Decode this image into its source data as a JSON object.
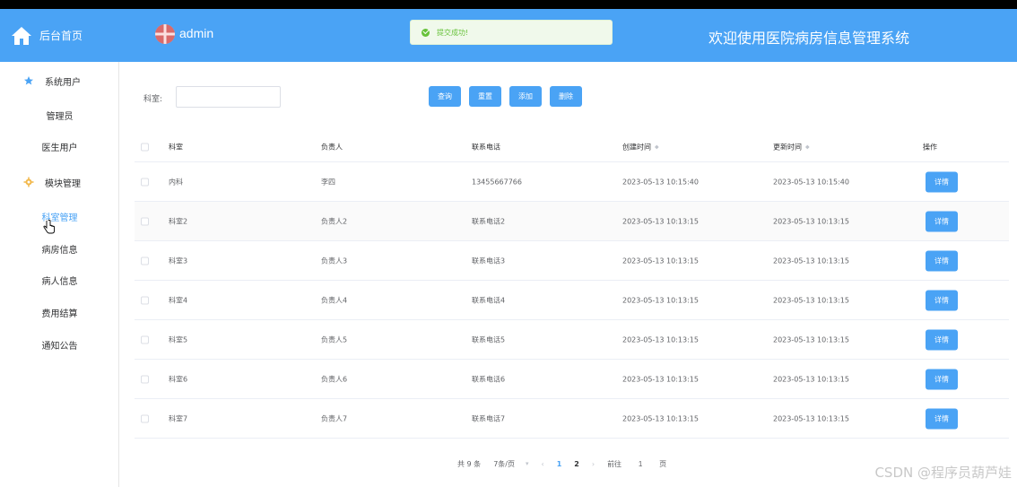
{
  "brand": {
    "label": "后台首页"
  },
  "header": {
    "username": "admin",
    "site_title": "欢迎使用医院病房信息管理系统",
    "toast": "提交成功!"
  },
  "sidebar": {
    "groups": [
      {
        "label": "系统用户",
        "icon": "star-icon",
        "items": [
          "管理员",
          "医生用户"
        ]
      },
      {
        "label": "模块管理",
        "icon": "gear-icon",
        "items": [
          "科室管理",
          "病房信息",
          "病人信息",
          "费用结算",
          "通知公告"
        ]
      }
    ],
    "active_item": "科室管理"
  },
  "search": {
    "label": "科室:",
    "value": "",
    "placeholder": ""
  },
  "toolbar": {
    "query": "查询",
    "reset": "重置",
    "add": "添加",
    "delete": "删除"
  },
  "table": {
    "headers": [
      "科室",
      "负责人",
      "联系电话",
      "创建时间",
      "更新时间",
      "操作"
    ],
    "rows": [
      [
        "内科",
        "李四",
        "13455667766",
        "2023-05-13 10:15:40",
        "2023-05-13 10:15:40"
      ],
      [
        "科室2",
        "负责人2",
        "联系电话2",
        "2023-05-13 10:13:15",
        "2023-05-13 10:13:15"
      ],
      [
        "科室3",
        "负责人3",
        "联系电话3",
        "2023-05-13 10:13:15",
        "2023-05-13 10:13:15"
      ],
      [
        "科室4",
        "负责人4",
        "联系电话4",
        "2023-05-13 10:13:15",
        "2023-05-13 10:13:15"
      ],
      [
        "科室5",
        "负责人5",
        "联系电话5",
        "2023-05-13 10:13:15",
        "2023-05-13 10:13:15"
      ],
      [
        "科室6",
        "负责人6",
        "联系电话6",
        "2023-05-13 10:13:15",
        "2023-05-13 10:13:15"
      ],
      [
        "科室7",
        "负责人7",
        "联系电话7",
        "2023-05-13 10:13:15",
        "2023-05-13 10:13:15"
      ]
    ],
    "detail_label": "详情"
  },
  "pagination": {
    "total": "共 9 条",
    "page_size": "7条/页",
    "pages": [
      "1",
      "2"
    ],
    "current_page": "1",
    "goto_prefix": "前往",
    "goto_value": "1",
    "goto_suffix": "页"
  },
  "watermark": "CSDN @程序员葫芦娃",
  "colors": {
    "primary": "#4aa3f5",
    "success": "#67c23a"
  }
}
